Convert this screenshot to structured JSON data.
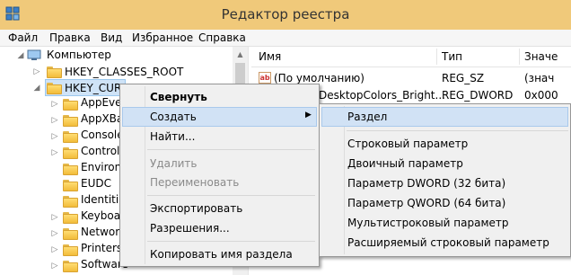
{
  "window": {
    "title": "Редактор реестра",
    "titlebar_color": "#f0c97a"
  },
  "menubar": {
    "items": [
      "Файл",
      "Правка",
      "Вид",
      "Избранное",
      "Справка"
    ]
  },
  "tree": {
    "root": "Компьютер",
    "hives": [
      "HKEY_CLASSES_ROOT",
      "HKEY_CURRENT_USER"
    ],
    "children": [
      "AppEve",
      "AppXBa",
      "Console",
      "Control",
      "Environ",
      "EUDC",
      "Identiti",
      "Keyboa",
      "Networ",
      "Printers",
      "Software"
    ]
  },
  "list": {
    "columns": [
      "Имя",
      "Тип",
      "Значе"
    ],
    "rows": [
      {
        "icon": "string-value-icon",
        "name": "(По умолчанию)",
        "type": "REG_SZ",
        "value": "(знач"
      },
      {
        "icon": "binary-value-icon",
        "name": "DesktopColors_Bright...",
        "type": "REG_DWORD",
        "value": "0x000"
      }
    ]
  },
  "context_menu": {
    "items": [
      "Свернуть",
      "Создать",
      "Найти...",
      "Удалить",
      "Переименовать",
      "Экспортировать",
      "Разрешения...",
      "Копировать имя раздела"
    ],
    "highlighted": "Создать",
    "highlight_color": "#d1e2f5"
  },
  "submenu": {
    "items": [
      "Раздел",
      "Строковый параметр",
      "Двоичный параметр",
      "Параметр DWORD (32 бита)",
      "Параметр QWORD (64 бита)",
      "Мультистроковый параметр",
      "Расширяемый строковый параметр"
    ],
    "highlighted": "Раздел"
  }
}
